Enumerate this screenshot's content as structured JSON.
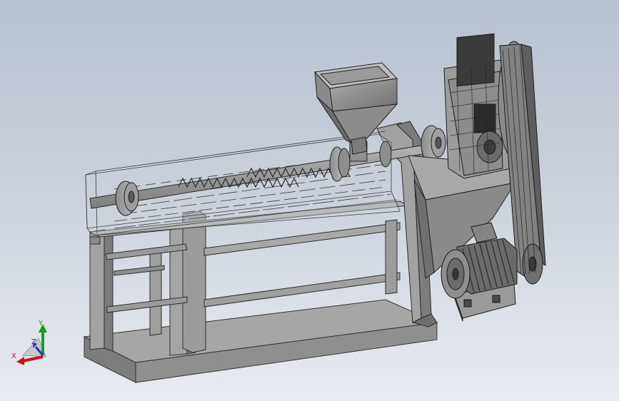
{
  "viewport": {
    "background_top": "#b9c2d0",
    "background_bottom": "#e9ecf1",
    "model_fill": "#9a9a9a",
    "model_edge": "#2a2a2a"
  },
  "triad": {
    "x_label": "X",
    "y_label": "Y",
    "z_label": "Z",
    "x_color": "#c8141e",
    "y_color": "#1a9a2a",
    "z_color": "#2233bb"
  }
}
